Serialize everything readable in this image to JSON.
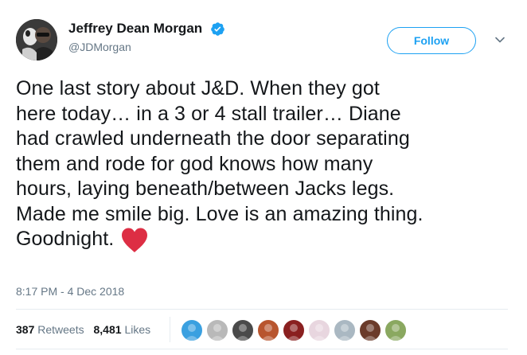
{
  "user": {
    "display_name": "Jeffrey Dean Morgan",
    "handle": "@JDMorgan",
    "verified_icon": "verified-badge-icon"
  },
  "actions": {
    "follow_label": "Follow",
    "more_icon": "chevron-down-icon"
  },
  "tweet": {
    "lines": [
      "One last story about J&D. When they got",
      "here today… in a 3 or 4 stall trailer… Diane",
      "had crawled underneath the door separating",
      "them and rode for god knows how many",
      "hours, laying beneath/between Jacks legs.",
      "Made me smile big. Love is an amazing thing.",
      "Goodnight."
    ],
    "emoji_icon": "red-heart-icon",
    "timestamp": "8:17 PM - 4 Dec 2018"
  },
  "stats": {
    "retweets_count": "387",
    "retweets_label": "Retweets",
    "likes_count": "8,481",
    "likes_label": "Likes"
  },
  "likers": [
    {
      "name": "liker-avatar-1",
      "color": "#3aa0e0"
    },
    {
      "name": "liker-avatar-2",
      "color": "#b9b9b9"
    },
    {
      "name": "liker-avatar-3",
      "color": "#4a4a4a"
    },
    {
      "name": "liker-avatar-4",
      "color": "#b8552e"
    },
    {
      "name": "liker-avatar-5",
      "color": "#8a2020"
    },
    {
      "name": "liker-avatar-6",
      "color": "#e8d6df"
    },
    {
      "name": "liker-avatar-7",
      "color": "#aab8c2"
    },
    {
      "name": "liker-avatar-8",
      "color": "#6b3b2a"
    },
    {
      "name": "liker-avatar-9",
      "color": "#8aa860"
    }
  ],
  "colors": {
    "accent": "#1da1f2",
    "heart": "#e0245e",
    "muted": "#657786"
  }
}
